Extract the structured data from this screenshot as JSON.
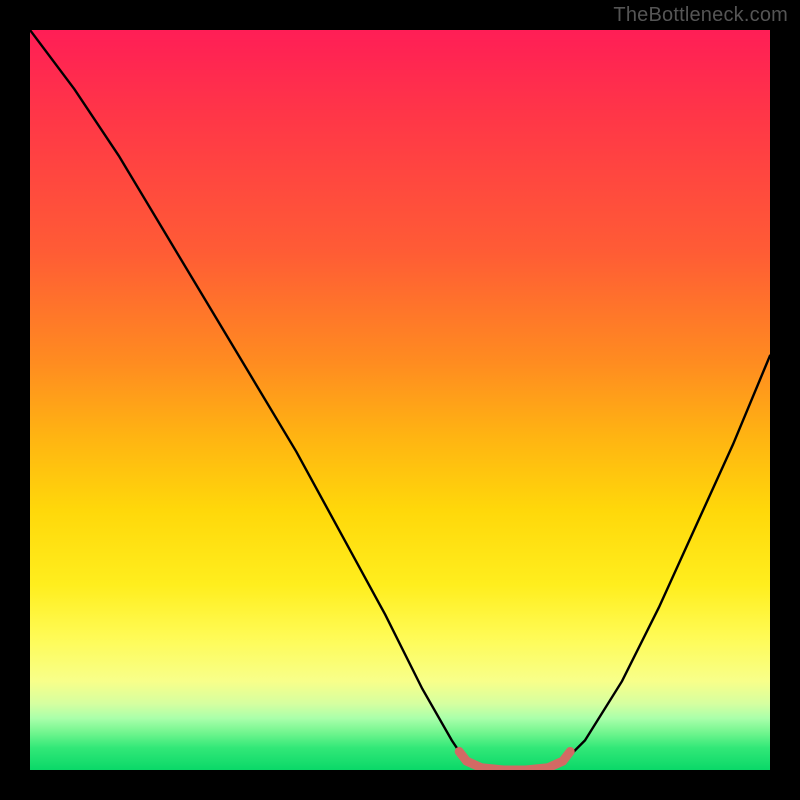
{
  "attribution": "TheBottleneck.com",
  "colors": {
    "curve": "#000000",
    "marker": "#d26a64",
    "gradient_top": "#ff1e56",
    "gradient_bottom": "#0ad868",
    "frame": "#000000"
  },
  "chart_data": {
    "type": "line",
    "title": "",
    "xlabel": "",
    "ylabel": "",
    "xlim": [
      0,
      100
    ],
    "ylim": [
      0,
      100
    ],
    "grid": false,
    "curve": [
      {
        "x": 0,
        "y": 100
      },
      {
        "x": 6,
        "y": 92
      },
      {
        "x": 12,
        "y": 83
      },
      {
        "x": 18,
        "y": 73
      },
      {
        "x": 24,
        "y": 63
      },
      {
        "x": 30,
        "y": 53
      },
      {
        "x": 36,
        "y": 43
      },
      {
        "x": 42,
        "y": 32
      },
      {
        "x": 48,
        "y": 21
      },
      {
        "x": 53,
        "y": 11
      },
      {
        "x": 57,
        "y": 4
      },
      {
        "x": 59,
        "y": 1
      },
      {
        "x": 61,
        "y": 0
      },
      {
        "x": 70,
        "y": 0
      },
      {
        "x": 72,
        "y": 1
      },
      {
        "x": 75,
        "y": 4
      },
      {
        "x": 80,
        "y": 12
      },
      {
        "x": 85,
        "y": 22
      },
      {
        "x": 90,
        "y": 33
      },
      {
        "x": 95,
        "y": 44
      },
      {
        "x": 100,
        "y": 56
      }
    ],
    "marker_segment": [
      {
        "x": 58,
        "y": 2.5
      },
      {
        "x": 59,
        "y": 1.2
      },
      {
        "x": 61,
        "y": 0.3
      },
      {
        "x": 64,
        "y": 0
      },
      {
        "x": 67,
        "y": 0
      },
      {
        "x": 70,
        "y": 0.3
      },
      {
        "x": 72,
        "y": 1.2
      },
      {
        "x": 73,
        "y": 2.5
      }
    ],
    "annotations": []
  }
}
